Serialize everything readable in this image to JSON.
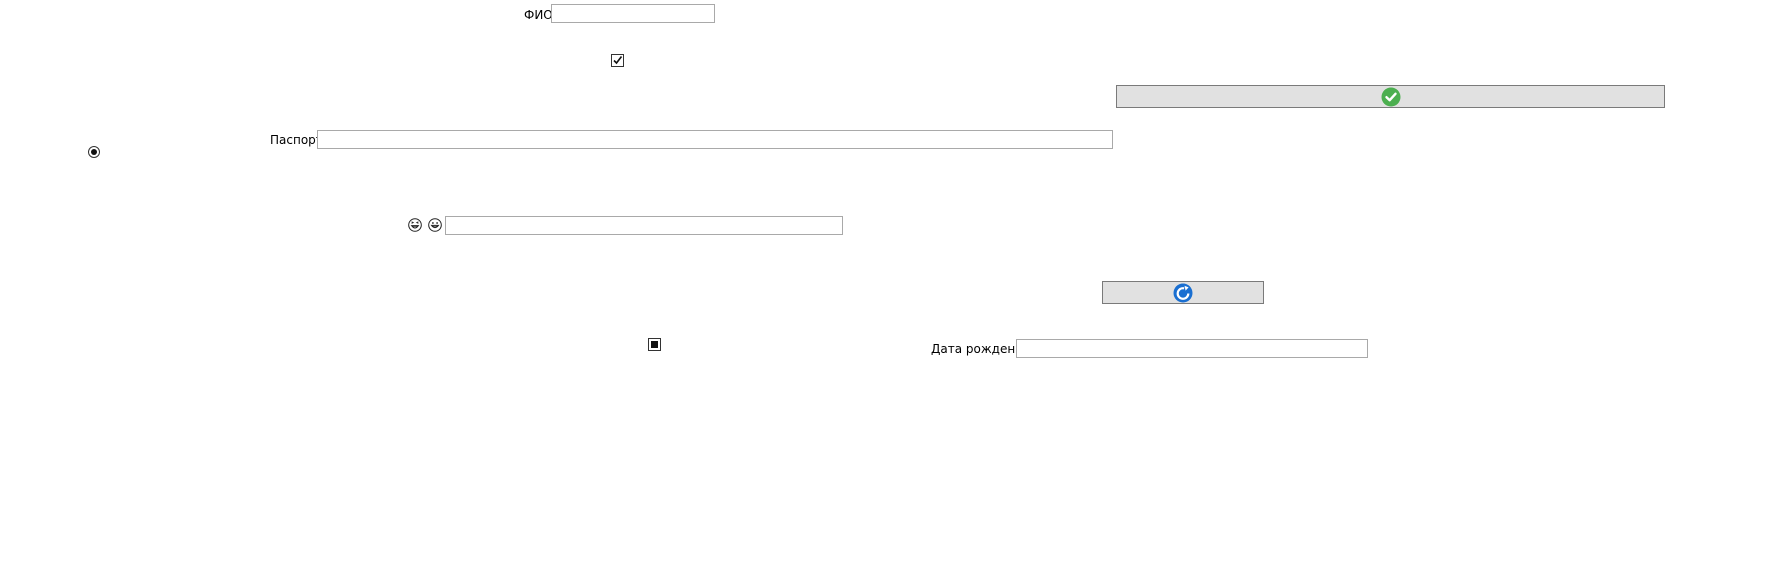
{
  "form": {
    "fio": {
      "label": "ФИО",
      "value": ""
    },
    "passport": {
      "label": "Паспорт",
      "value": ""
    },
    "emoji_field": {
      "icons": [
        "laughing-face-icon",
        "grinning-face-icon"
      ],
      "value": ""
    },
    "birth_date": {
      "label": "Дата рождения",
      "value": ""
    },
    "checkbox_checked": true,
    "checkbox_indeterminate": true,
    "radio_selected": true
  },
  "buttons": {
    "confirm": {
      "icon": "green-check-circle-icon",
      "color": "#4caf50"
    },
    "refresh": {
      "icon": "blue-refresh-icon",
      "color": "#1a6fd1"
    }
  }
}
